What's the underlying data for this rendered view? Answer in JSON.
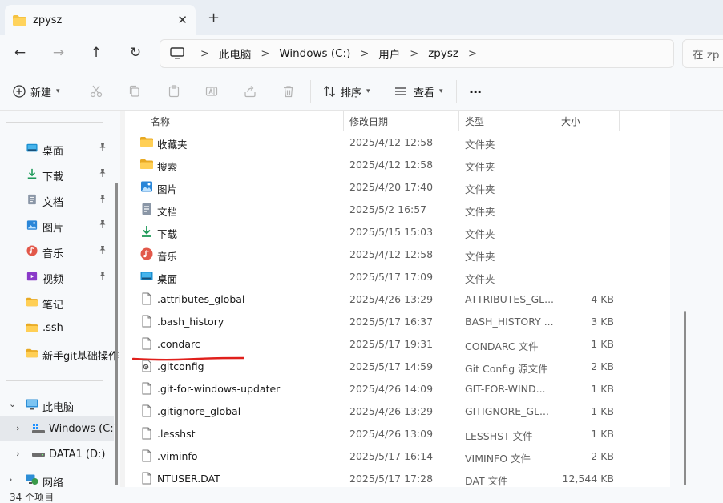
{
  "tab": {
    "title": "zpysz",
    "close": "✕",
    "add": "+"
  },
  "nav": {
    "back": "←",
    "forward": "→",
    "up": "↑",
    "refresh": "↻",
    "breadcrumbs": [
      "此电脑",
      "Windows (C:)",
      "用户",
      "zpysz"
    ],
    "search_placeholder": "在 zp"
  },
  "toolbar": {
    "new_label": "新建",
    "sort_label": "排序",
    "view_label": "查看",
    "more_label": "···"
  },
  "sidebar": {
    "quick_access": [
      {
        "label": "桌面",
        "icon": "desktop-icon",
        "pinned": true
      },
      {
        "label": "下载",
        "icon": "download-icon",
        "pinned": true
      },
      {
        "label": "文档",
        "icon": "document-icon",
        "pinned": true
      },
      {
        "label": "图片",
        "icon": "picture-icon",
        "pinned": true
      },
      {
        "label": "音乐",
        "icon": "music-icon",
        "pinned": true
      },
      {
        "label": "视频",
        "icon": "video-icon",
        "pinned": true
      },
      {
        "label": "笔记",
        "icon": "folder-icon",
        "pinned": false
      },
      {
        "label": ".ssh",
        "icon": "folder-icon",
        "pinned": false
      },
      {
        "label": "新手git基础操作",
        "icon": "folder-icon",
        "pinned": false
      }
    ],
    "tree": [
      {
        "label": "此电脑",
        "icon": "pc-icon",
        "expanded": true
      },
      {
        "label": "Windows (C:)",
        "icon": "windows-drive-icon",
        "selected": true
      },
      {
        "label": "DATA1 (D:)",
        "icon": "drive-icon"
      },
      {
        "label": "网络",
        "icon": "network-icon"
      }
    ]
  },
  "columns": {
    "name": "名称",
    "date": "修改日期",
    "type": "类型",
    "size": "大小"
  },
  "files": [
    {
      "name": "收藏夹",
      "date": "2025/4/12 12:58",
      "type": "文件夹",
      "size": "",
      "icon": "folder-icon"
    },
    {
      "name": "搜索",
      "date": "2025/4/12 12:58",
      "type": "文件夹",
      "size": "",
      "icon": "folder-icon"
    },
    {
      "name": "图片",
      "date": "2025/4/20 17:40",
      "type": "文件夹",
      "size": "",
      "icon": "picture-icon"
    },
    {
      "name": "文档",
      "date": "2025/5/2 16:57",
      "type": "文件夹",
      "size": "",
      "icon": "document-icon"
    },
    {
      "name": "下载",
      "date": "2025/5/15 15:03",
      "type": "文件夹",
      "size": "",
      "icon": "download-icon"
    },
    {
      "name": "音乐",
      "date": "2025/4/12 12:58",
      "type": "文件夹",
      "size": "",
      "icon": "music-icon"
    },
    {
      "name": "桌面",
      "date": "2025/5/17 17:09",
      "type": "文件夹",
      "size": "",
      "icon": "desktop-icon"
    },
    {
      "name": ".attributes_global",
      "date": "2025/4/26 13:29",
      "type": "ATTRIBUTES_GL...",
      "size": "4 KB",
      "icon": "file-icon"
    },
    {
      "name": ".bash_history",
      "date": "2025/5/17 16:37",
      "type": "BASH_HISTORY ...",
      "size": "3 KB",
      "icon": "file-icon"
    },
    {
      "name": ".condarc",
      "date": "2025/5/17 19:31",
      "type": "CONDARC 文件",
      "size": "1 KB",
      "icon": "file-icon"
    },
    {
      "name": ".gitconfig",
      "date": "2025/5/17 14:59",
      "type": "Git Config 源文件",
      "size": "2 KB",
      "icon": "config-file-icon"
    },
    {
      "name": ".git-for-windows-updater",
      "date": "2025/4/26 14:09",
      "type": "GIT-FOR-WIND...",
      "size": "1 KB",
      "icon": "file-icon"
    },
    {
      "name": ".gitignore_global",
      "date": "2025/4/26 13:29",
      "type": "GITIGNORE_GL...",
      "size": "1 KB",
      "icon": "file-icon"
    },
    {
      "name": ".lesshst",
      "date": "2025/4/26 13:09",
      "type": "LESSHST 文件",
      "size": "1 KB",
      "icon": "file-icon"
    },
    {
      "name": ".viminfo",
      "date": "2025/5/17 16:14",
      "type": "VIMINFO 文件",
      "size": "2 KB",
      "icon": "file-icon"
    },
    {
      "name": "NTUSER.DAT",
      "date": "2025/5/17 17:28",
      "type": "DAT 文件",
      "size": "12,544 KB",
      "icon": "file-icon"
    }
  ],
  "status": {
    "item_count": "34 个项目"
  },
  "colors": {
    "folder": "#f5c242",
    "accent": "#0067c0",
    "annotation": "#e0201c"
  }
}
